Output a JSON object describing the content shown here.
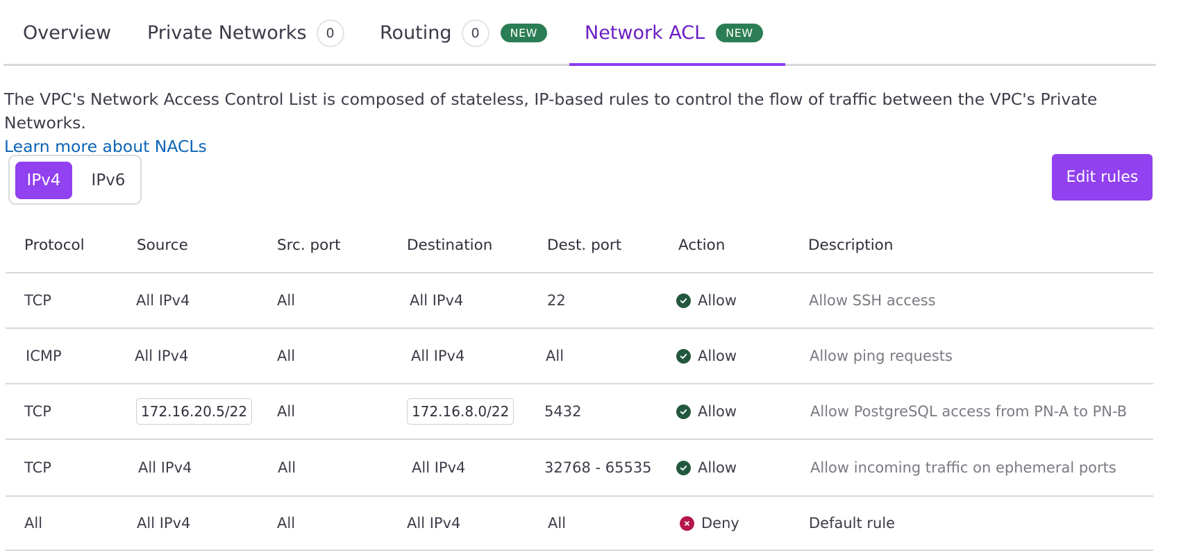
{
  "tabs": [
    {
      "label": "Overview"
    },
    {
      "label": "Private Networks",
      "count": "0"
    },
    {
      "label": "Routing",
      "count": "0",
      "badge": "NEW"
    },
    {
      "label": "Network ACL",
      "badge": "NEW",
      "active": true
    }
  ],
  "intro": {
    "text": "The VPC's Network Access Control List is composed of stateless, IP-based rules to control the flow of traffic between the VPC's Private Networks.",
    "link": "Learn more about NACLs"
  },
  "ip_toggle": {
    "selected": "IPv4",
    "other": "IPv6"
  },
  "edit_button": "Edit rules",
  "table": {
    "columns": [
      "Protocol",
      "Source",
      "Src. port",
      "Destination",
      "Dest. port",
      "Action",
      "Description"
    ],
    "rows": [
      {
        "protocol": "TCP",
        "source": "All IPv4",
        "src_port": "All",
        "destination": "All IPv4",
        "dest_port": "22",
        "action": "Allow",
        "description": "Allow SSH access"
      },
      {
        "protocol": "ICMP",
        "source": "All IPv4",
        "src_port": "All",
        "destination": "All IPv4",
        "dest_port": "All",
        "action": "Allow",
        "description": "Allow ping requests"
      },
      {
        "protocol": "TCP",
        "source": "172.16.20.5/22",
        "src_port": "All",
        "destination": "172.16.8.0/22",
        "dest_port": "5432",
        "action": "Allow",
        "description": "Allow PostgreSQL access from PN-A to PN-B"
      },
      {
        "protocol": "TCP",
        "source": "All IPv4",
        "src_port": "All",
        "destination": "All IPv4",
        "dest_port": "32768 - 65535",
        "action": "Allow",
        "description": "Allow incoming traffic on ephemeral ports"
      },
      {
        "protocol": "All",
        "source": "All IPv4",
        "src_port": "All",
        "destination": "All IPv4",
        "dest_port": "All",
        "action": "Deny",
        "description": "Default rule"
      }
    ]
  },
  "colors": {
    "accent": "#9141ef",
    "allow": "#23573f",
    "deny": "#b4164d",
    "new_badge": "#2b7d55",
    "link": "#0b63b4"
  }
}
